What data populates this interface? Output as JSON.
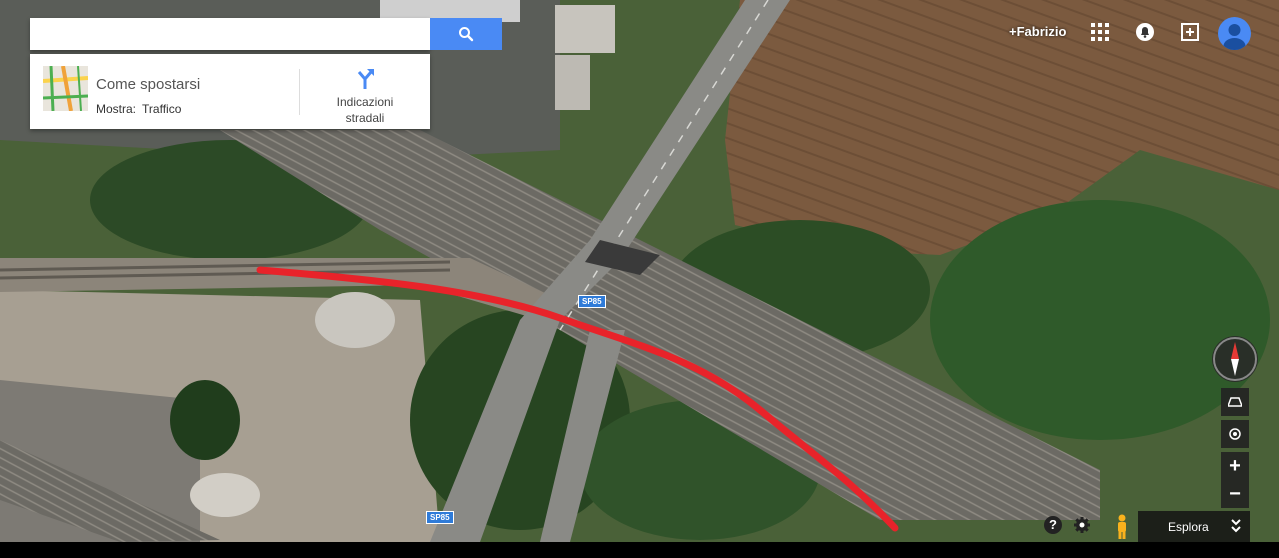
{
  "search": {
    "value": "",
    "placeholder": ""
  },
  "card": {
    "title": "Come spostarsi",
    "mostra_label": "Mostra:",
    "mostra_value": "Traffico",
    "directions_label_line1": "Indicazioni",
    "directions_label_line2": "stradali"
  },
  "header": {
    "user": "+Fabrizio"
  },
  "road_labels": [
    "SP85",
    "SP85"
  ],
  "controls": {
    "help": "?",
    "zoom_in": "+",
    "zoom_out": "−",
    "explore": "Esplora"
  },
  "icons": [
    "search-icon",
    "directions-icon",
    "apps-grid-icon",
    "notification-bell-icon",
    "share-plus-icon",
    "avatar-icon",
    "compass-icon",
    "tilt-icon",
    "my-location-icon",
    "help-icon",
    "gear-icon",
    "pegman-icon",
    "chevron-down-icon"
  ],
  "colors": {
    "route": "#e8232a",
    "accent": "#4a8af4",
    "field": "#7a5a3c",
    "vegetation": "#2f5a2a"
  }
}
